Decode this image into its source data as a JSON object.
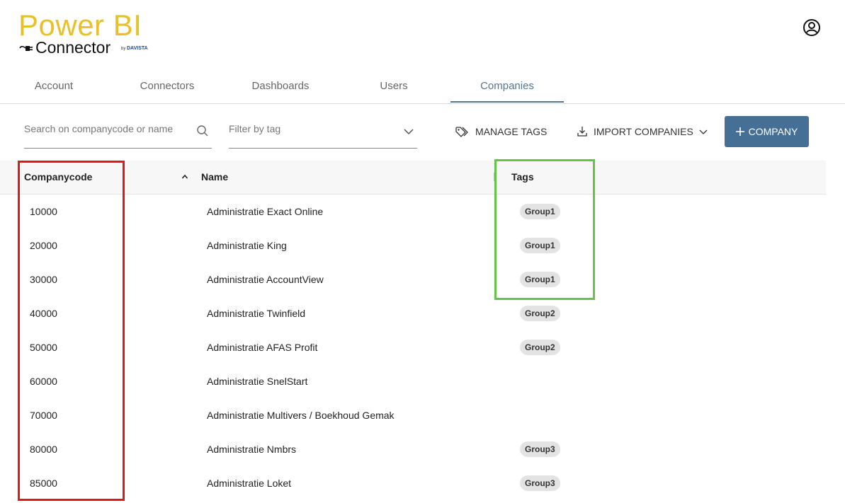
{
  "logo": {
    "title": "Power BI",
    "subtitle": "Connector",
    "by": "by",
    "brand": "DAVISTA"
  },
  "tabs": [
    {
      "label": "Account"
    },
    {
      "label": "Connectors"
    },
    {
      "label": "Dashboards"
    },
    {
      "label": "Users"
    },
    {
      "label": "Companies",
      "active": true
    }
  ],
  "toolbar": {
    "search_placeholder": "Search on companycode or name",
    "filter_placeholder": "Filter by tag",
    "manage_tags_label": "MANAGE TAGS",
    "import_label": "IMPORT COMPANIES",
    "add_company_label": "COMPANY"
  },
  "table": {
    "columns": [
      "Companycode",
      "Name",
      "Tags"
    ],
    "rows": [
      {
        "code": "10000",
        "name": "Administratie Exact Online",
        "tag": "Group1"
      },
      {
        "code": "20000",
        "name": "Administratie King",
        "tag": "Group1"
      },
      {
        "code": "30000",
        "name": "Administratie AccountView",
        "tag": "Group1"
      },
      {
        "code": "40000",
        "name": "Administratie Twinfield",
        "tag": "Group2"
      },
      {
        "code": "50000",
        "name": "Administratie AFAS Profit",
        "tag": "Group2"
      },
      {
        "code": "60000",
        "name": "Administratie SnelStart",
        "tag": ""
      },
      {
        "code": "70000",
        "name": "Administratie Multivers / Boekhoud Gemak",
        "tag": ""
      },
      {
        "code": "80000",
        "name": "Administratie Nmbrs",
        "tag": "Group3"
      },
      {
        "code": "85000",
        "name": "Administratie Loket",
        "tag": "Group3"
      }
    ]
  },
  "colors": {
    "accent": "#466f96",
    "active_tab": "#557590",
    "logo_yellow": "#e8c12a",
    "highlight_red": "#e01818",
    "highlight_green": "#67c14a"
  },
  "icons": [
    "plug-icon",
    "user-avatar-icon",
    "search-icon",
    "chevron-down-icon",
    "tag-icon",
    "import-icon",
    "plus-icon",
    "sort-ascending-icon"
  ]
}
